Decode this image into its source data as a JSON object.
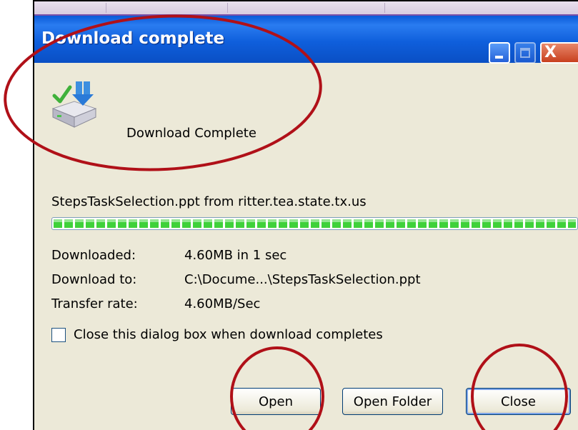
{
  "window": {
    "title": "Download complete",
    "controls": {
      "minimize_icon": "minimize-icon",
      "maximize_icon": "maximize-icon",
      "close_glyph": "X"
    }
  },
  "header": {
    "icon": "download-complete-icon",
    "status_text": "Download Complete"
  },
  "file": {
    "source_line": "StepsTaskSelection.ppt from ritter.tea.state.tx.us"
  },
  "progress": {
    "percent": 100,
    "color": "#3fd13a"
  },
  "details": [
    {
      "label": "Downloaded:",
      "value": "4.60MB in 1 sec"
    },
    {
      "label": "Download to:",
      "value": "C:\\Docume...\\StepsTaskSelection.ppt"
    },
    {
      "label": "Transfer rate:",
      "value": "4.60MB/Sec"
    }
  ],
  "options": {
    "close_when_complete_label": "Close this dialog box when download completes",
    "close_when_complete_checked": false
  },
  "buttons": {
    "open": "Open",
    "open_folder": "Open Folder",
    "close": "Close"
  },
  "colors": {
    "titlebar": "#0a5ad8",
    "dialog_bg": "#ece9d8",
    "annotation_circle": "#b01018"
  }
}
